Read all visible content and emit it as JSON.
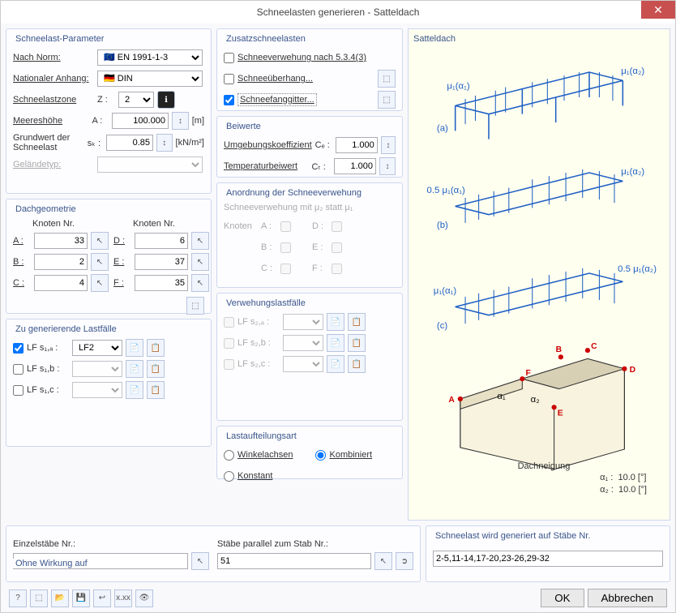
{
  "window": {
    "title": "Schneelasten generieren  -  Satteldach",
    "close": "✕"
  },
  "params": {
    "title": "Schneelast-Parameter",
    "norm_lbl": "Nach Norm:",
    "norm_val": "EN 1991-1-3",
    "annex_lbl": "Nationaler Anhang:",
    "annex_val": "DIN",
    "zone_lbl": "Schneelastzone",
    "zone_sym": "Z :",
    "zone_val": "2",
    "alt_lbl": "Meereshöhe",
    "alt_sym": "A :",
    "alt_val": "100.000",
    "alt_unit": "[m]",
    "sk_lbl1": "Grundwert der",
    "sk_lbl2": "Schneelast",
    "sk_sym": "sₖ :",
    "sk_val": "0.85",
    "sk_unit": "[kN/m²]",
    "terrain_lbl": "Geländetyp:"
  },
  "zusatz": {
    "title": "Zusatzschneelasten",
    "verwehung": "Schneeverwehung nach 5.3.4(3)",
    "ueberhang": "Schneeüberhang...",
    "gitter": "Schneefanggitter...",
    "gitter_checked": true
  },
  "beiwerte": {
    "title": "Beiwerte",
    "ce_lbl": "Umgebungskoeffizient",
    "ce_sym": "Cₑ :",
    "ce_val": "1.000",
    "ct_lbl": "Temperaturbeiwert",
    "ct_sym": "Cₜ :",
    "ct_val": "1.000"
  },
  "geom": {
    "title": "Dachgeometrie",
    "knoten": "Knoten Nr.",
    "A": "A :",
    "Av": "33",
    "B": "B :",
    "Bv": "2",
    "C": "C :",
    "Cv": "4",
    "D": "D :",
    "Dv": "6",
    "E": "E :",
    "Ev": "37",
    "F": "F :",
    "Fv": "35"
  },
  "anordnung": {
    "title": "Anordnung der Schneeverwehung",
    "subtitle": "Schneeverwehung mit μ₂ statt μ₁",
    "knoten": "Knoten",
    "A": "A :",
    "B": "B :",
    "C": "C :",
    "D": "D :",
    "E": "E :",
    "F": "F :"
  },
  "lf": {
    "title": "Zu generierende Lastfälle",
    "a_lbl": "LF s₁,ₐ :",
    "a_val": "LF2",
    "a_chk": true,
    "b_lbl": "LF s₁,b :",
    "c_lbl": "LF s₁,c :"
  },
  "vf": {
    "title": "Verwehungslastfälle",
    "a_lbl": "LF s₂,ₐ :",
    "b_lbl": "LF s₂,b :",
    "c_lbl": "LF s₂,c :"
  },
  "lastauf": {
    "title": "Lastaufteilungsart",
    "winkel": "Winkelachsen",
    "kombi": "Kombiniert",
    "konst": "Konstant"
  },
  "ohne": {
    "title": "Ohne Wirkung auf",
    "einzel_lbl": "Einzelstäbe Nr.:",
    "parallel_lbl": "Stäbe parallel zum Stab Nr.:",
    "parallel_val": "51"
  },
  "diagram": {
    "title": "Satteldach",
    "neigung": "Dachneigung",
    "a1_lbl": "α₁ :",
    "a1_val": "10.0 [°]",
    "a2_lbl": "α₂ :",
    "a2_val": "10.0 [°]",
    "mu1a1": "μ₁(α₁)",
    "mu1a2": "μ₁(α₂)",
    "halfmu1a1": "0.5 μ₁(α₁)",
    "halfmu1a2": "0.5 μ₁(α₂)",
    "a": "(a)",
    "b": "(b)",
    "c": "(c)",
    "nA": "A",
    "nB": "B",
    "nC": "C",
    "nD": "D",
    "nE": "E",
    "nF": "F"
  },
  "generated": {
    "title": "Schneelast wird generiert auf Stäbe Nr.",
    "val": "2-5,11-14,17-20,23-26,29-32"
  },
  "footer": {
    "ok": "OK",
    "cancel": "Abbrechen"
  }
}
